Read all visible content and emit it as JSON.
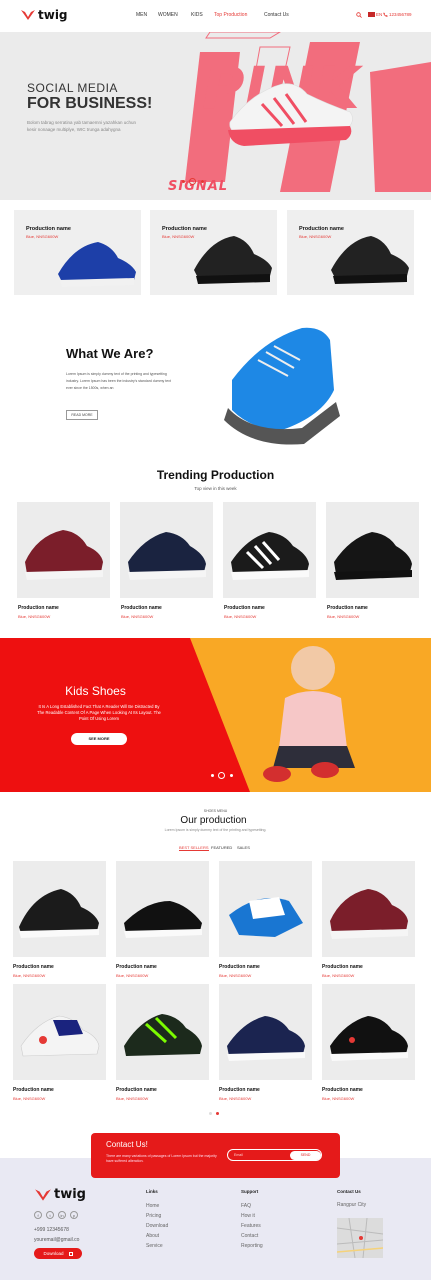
{
  "header": {
    "brand": "twig",
    "nav": [
      "MEN",
      "WOMEN",
      "KIDS",
      "Top Production",
      "Contact Us"
    ],
    "active_nav": "Top Production",
    "lang": "EN",
    "phone": "123456789",
    "accent_color": "#e53935"
  },
  "hero": {
    "subtitle": "SOCIAL MEDIA",
    "title": "FOR BUSINESS!",
    "text": "Bolom tabrag serratina yab tamaemni yazahkan uchun kesir nonaage multiplye, WIC trunga adahygna",
    "signal": "SIGNAL",
    "pink_text": "PINK"
  },
  "featured": [
    {
      "name": "Production name",
      "price": "Blue, NNSG600W"
    },
    {
      "name": "Production name",
      "price": "Blue, NNSG600W"
    },
    {
      "name": "Production name",
      "price": "Blue, NNSG600W"
    }
  ],
  "about": {
    "title": "What We Are?",
    "text": "Lorem Ipsum is simply dummy text of the printing and typesetting industry. Lorem Ipsum has been the industry's standard dummy text ever since the 1500s, when an",
    "button": "READ MORE"
  },
  "trending": {
    "title": "Trending Production",
    "subtitle": "Top view in this week",
    "items": [
      {
        "name": "Production name",
        "price": "Blue, NNSG600W"
      },
      {
        "name": "Production name",
        "price": "Blue, NNSG600W"
      },
      {
        "name": "Production name",
        "price": "Blue, NNSG600W"
      },
      {
        "name": "Production name",
        "price": "Blue, NNSG600W"
      }
    ]
  },
  "kids": {
    "title": "Kids Shoes",
    "text": "It Is A Long Established Fact That A Reader Will Be Distracted By The Readable Content Of A Page When Looking At Its Layout. The Point Of Using Lorem",
    "button": "SEE MORE"
  },
  "our_production": {
    "kicker": "SHOES MENU",
    "title": "Our production",
    "subtitle": "Lorem Ipsum is simply dummy text of the printing and typesetting.",
    "tabs": [
      "BEST SELLERS",
      "FEATURED",
      "SALES"
    ],
    "active_tab": "BEST SELLERS",
    "items": [
      {
        "name": "Production name",
        "price": "Blue, NNSG600W"
      },
      {
        "name": "Production name",
        "price": "Blue, NNSG600W"
      },
      {
        "name": "Production name",
        "price": "Blue, NNSG600W"
      },
      {
        "name": "Production name",
        "price": "Blue, NNSG600W"
      },
      {
        "name": "Production name",
        "price": "Blue, NNSG600W"
      },
      {
        "name": "Production name",
        "price": "Blue, NNSG600W"
      },
      {
        "name": "Production name",
        "price": "Blue, NNSG600W"
      },
      {
        "name": "Production name",
        "price": "Blue, NNSG600W"
      }
    ]
  },
  "contact_band": {
    "title": "Contact Us!",
    "text": "There are many variations of passages of Lorem Ipsum but the majority have suffered alteration.",
    "input_placeholder": "Email",
    "button": "SEND"
  },
  "footer": {
    "brand": "twig",
    "phone": "+999 12345678",
    "email": "youremail@gmail.co",
    "download": "Download",
    "links_title": "Links",
    "links": [
      "Home",
      "Pricing",
      "Download",
      "About",
      "Service"
    ],
    "support_title": "Support",
    "support": [
      "FAQ",
      "How it",
      "Features",
      "Contact",
      "Reporting"
    ],
    "contact_title": "Contact Us",
    "city": "Rangpur City"
  }
}
